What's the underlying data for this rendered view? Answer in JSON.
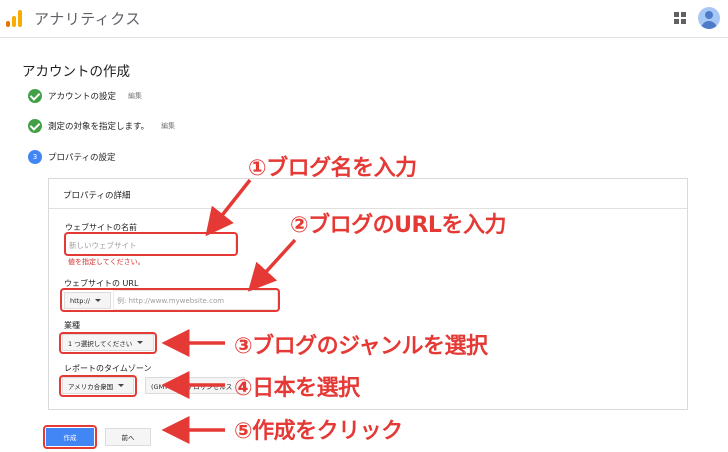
{
  "app": {
    "title": "アナリティクス"
  },
  "page": {
    "title": "アカウントの作成"
  },
  "steps": [
    {
      "label": "アカウントの設定",
      "edit": "編集",
      "state": "done"
    },
    {
      "label": "測定の対象を指定します。",
      "edit": "編集",
      "state": "done"
    },
    {
      "label": "プロパティの設定",
      "number": "3",
      "state": "current"
    }
  ],
  "card": {
    "title": "プロパティの詳細",
    "site_name": {
      "label": "ウェブサイトの名前",
      "placeholder": "新しいウェブサイト",
      "value": "",
      "error": "値を指定してください。"
    },
    "site_url": {
      "label": "ウェブサイトの URL",
      "protocol": "http://",
      "placeholder": "例: http://www.mywebsite.com",
      "value": ""
    },
    "industry": {
      "label": "業種",
      "selected": "1 つ選択してください"
    },
    "timezone": {
      "label": "レポートのタイムゾーン",
      "country": "アメリカ合衆国",
      "zone": "(GMT-08:00) ロサンゼルス"
    }
  },
  "buttons": {
    "create": "作成",
    "back": "前へ"
  },
  "annotations": {
    "a1": "①ブログ名を入力",
    "a2": "②ブログのURLを入力",
    "a3": "③ブログのジャンルを選択",
    "a4": "④日本を選択",
    "a5": "⑤作成をクリック"
  },
  "colors": {
    "accent": "#4285f4",
    "success": "#43a047",
    "annotation": "#e53935",
    "error": "#d32f2f"
  },
  "icons": [
    "analytics-logo-icon",
    "apps-grid-icon",
    "account-avatar-icon",
    "check-circle-icon",
    "dropdown-caret-icon",
    "arrow-icon"
  ]
}
